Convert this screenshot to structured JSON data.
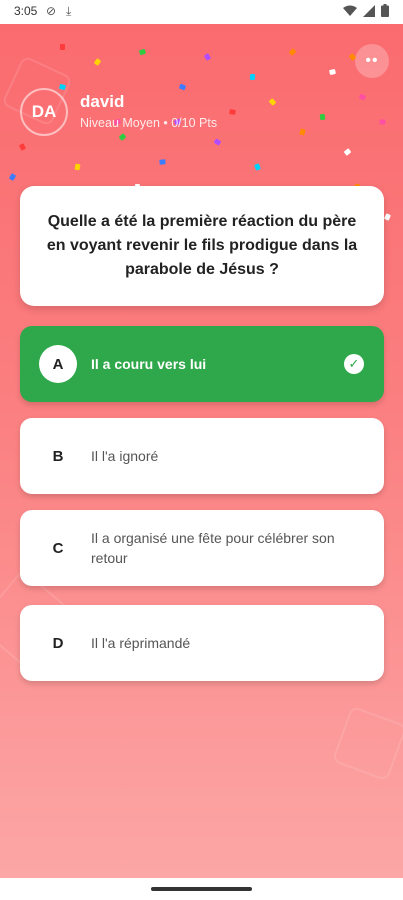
{
  "status_bar": {
    "time": "3:05"
  },
  "user": {
    "initials": "DA",
    "name": "david",
    "level": "Niveau Moyen • 0/10 Pts"
  },
  "question": {
    "text": "Quelle a été la première réaction du père en voyant revenir le fils prodigue dans la parabole de Jésus ?"
  },
  "options": [
    {
      "letter": "A",
      "text": "Il a couru vers lui",
      "state": "correct"
    },
    {
      "letter": "B",
      "text": "Il l'a ignoré",
      "state": "normal"
    },
    {
      "letter": "C",
      "text": "Il a organisé une fête pour célébrer son retour",
      "state": "normal"
    },
    {
      "letter": "D",
      "text": "Il l'a réprimandé",
      "state": "normal"
    }
  ],
  "icons": {
    "menu": "more-dots-icon",
    "check": "check-circle-icon",
    "wifi": "wifi-icon",
    "signal": "signal-icon",
    "battery": "battery-icon"
  },
  "colors": {
    "background_top": "#fa6b6f",
    "background_bottom": "#fca6a6",
    "correct": "#2ea84a",
    "card": "#ffffff"
  }
}
